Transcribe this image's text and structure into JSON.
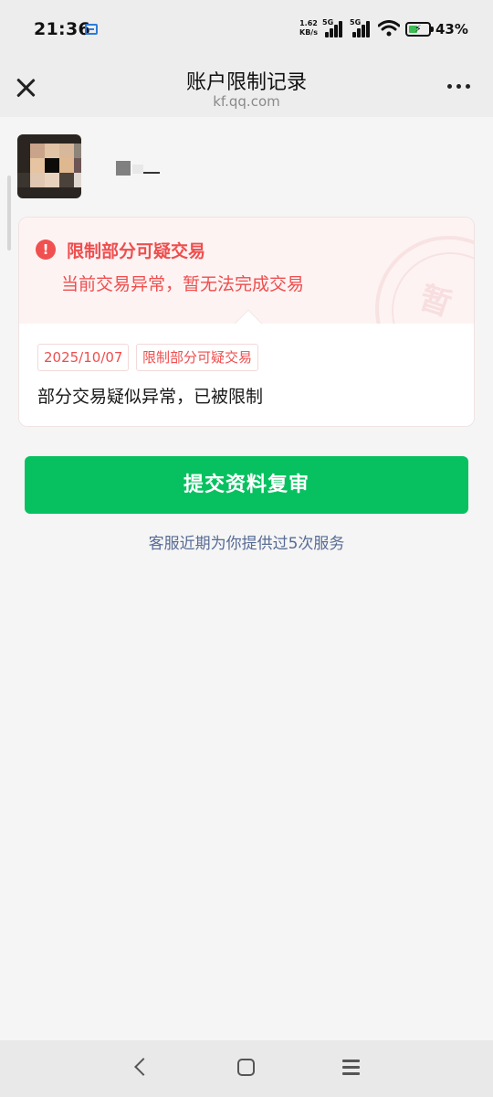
{
  "status_bar": {
    "time": "21:36",
    "speed_value": "1.62",
    "speed_unit": "KB/s",
    "network_1": "5G",
    "network_2": "5G",
    "battery_percent": "43%",
    "battery_level": 0.43,
    "icons": [
      "app-notification-icon",
      "signal-icon",
      "signal-icon",
      "wifi-icon",
      "battery-charging-icon"
    ]
  },
  "header": {
    "title": "账户限制记录",
    "subtitle": "kf.qq.com",
    "close_icon": "close-icon",
    "more_icon": "more-icon"
  },
  "alert": {
    "icon": "alert-circle-icon",
    "icon_glyph": "!",
    "title": "限制部分可疑交易",
    "description": "当前交易异常，暂无法完成交易",
    "stamp_text": "暂",
    "date_tag": "2025/10/07",
    "type_tag": "限制部分可疑交易",
    "detail": "部分交易疑似异常，已被限制",
    "accent_color": "#ef4e4e"
  },
  "actions": {
    "submit_label": "提交资料复审",
    "submit_color": "#07c160",
    "service_note": "客服近期为你提供过5次服务"
  },
  "nav": {
    "back_icon": "back-icon",
    "home_icon": "home-icon",
    "menu_icon": "menu-icon"
  }
}
